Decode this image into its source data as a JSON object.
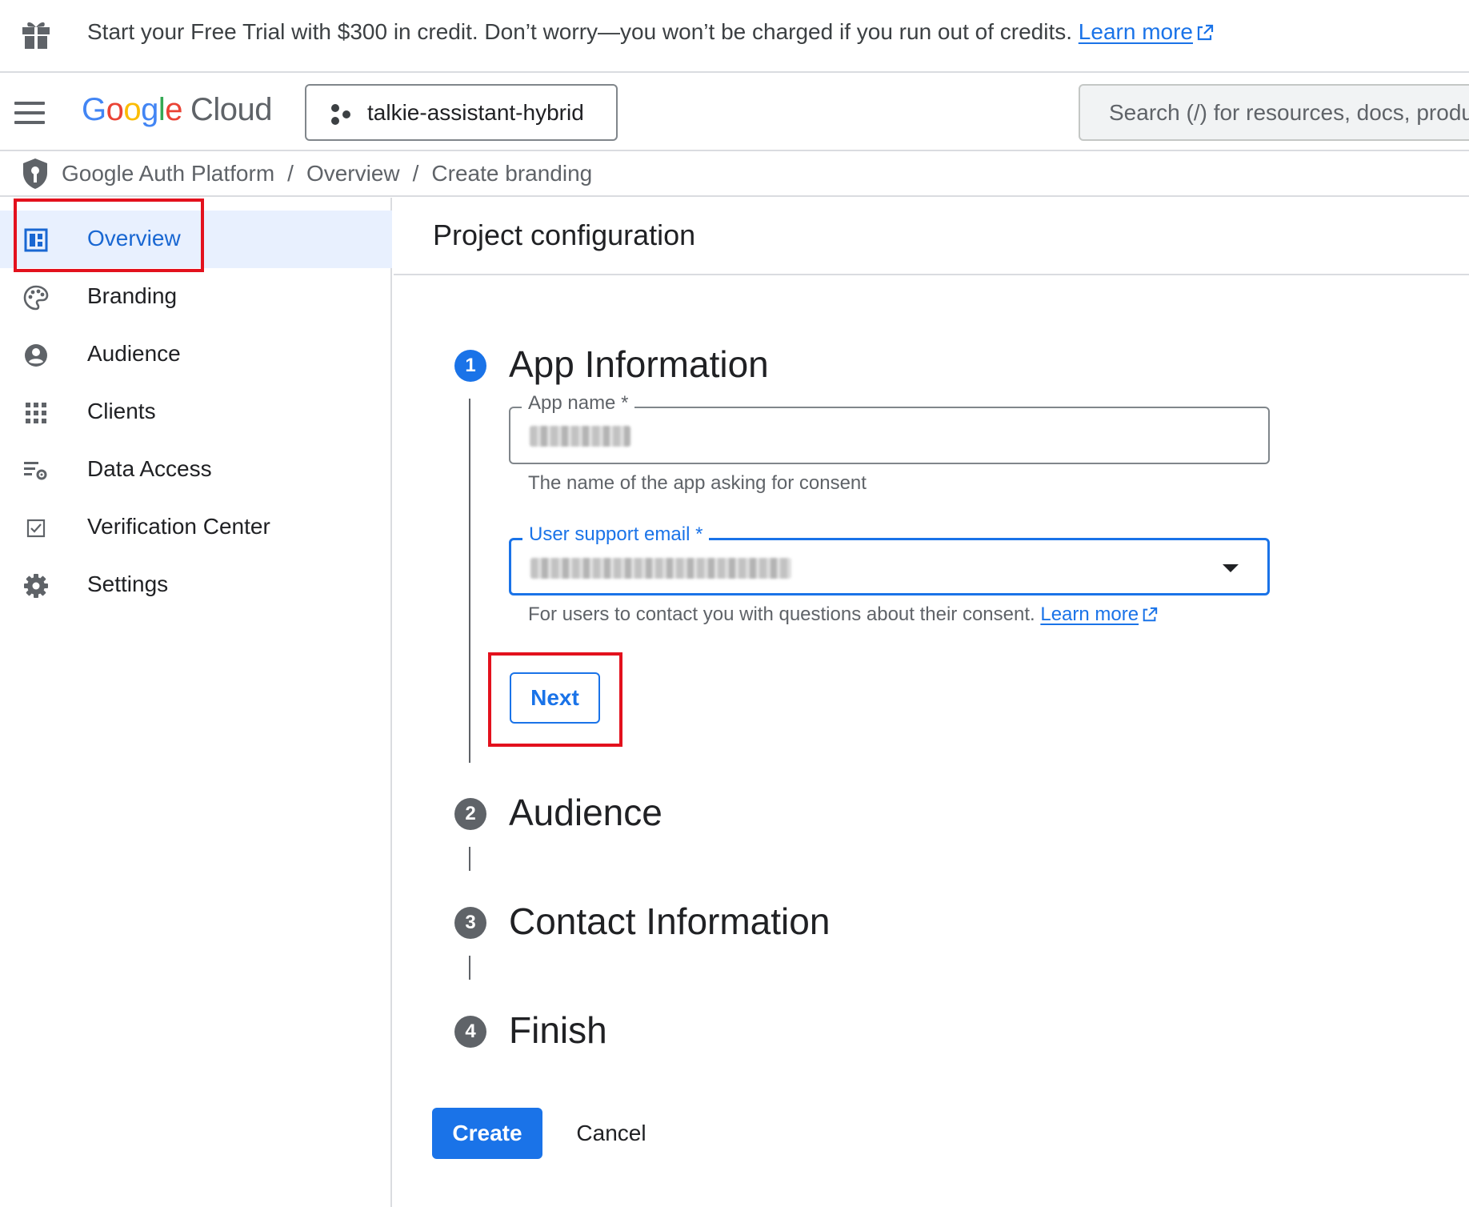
{
  "banner": {
    "text": "Start your Free Trial with $300 in credit. Don’t worry—you won’t be charged if you run out of credits.",
    "link_label": "Learn more"
  },
  "topbar": {
    "logo_letters": [
      "G",
      "o",
      "o",
      "g",
      "l",
      "e"
    ],
    "logo_product": "Cloud",
    "project_name": "talkie-assistant-hybrid",
    "search_placeholder": "Search (/) for resources, docs, products, and more"
  },
  "breadcrumb": {
    "items": [
      "Google Auth Platform",
      "Overview",
      "Create branding"
    ],
    "separator": "/"
  },
  "sidebar": {
    "items": [
      {
        "label": "Overview",
        "icon": "dashboard-icon",
        "active": true
      },
      {
        "label": "Branding",
        "icon": "palette-icon",
        "active": false
      },
      {
        "label": "Audience",
        "icon": "account-circle-icon",
        "active": false
      },
      {
        "label": "Clients",
        "icon": "apps-grid-icon",
        "active": false
      },
      {
        "label": "Data Access",
        "icon": "data-settings-icon",
        "active": false
      },
      {
        "label": "Verification Center",
        "icon": "verified-checkbox-icon",
        "active": false
      },
      {
        "label": "Settings",
        "icon": "gear-icon",
        "active": false
      }
    ]
  },
  "main": {
    "title": "Project configuration",
    "steps": [
      {
        "number": "1",
        "title": "App Information",
        "current": true
      },
      {
        "number": "2",
        "title": "Audience",
        "current": false
      },
      {
        "number": "3",
        "title": "Contact Information",
        "current": false
      },
      {
        "number": "4",
        "title": "Finish",
        "current": false
      }
    ],
    "app_name": {
      "label": "App name *",
      "value": "",
      "hint": "The name of the app asking for consent"
    },
    "support_email": {
      "label": "User support email *",
      "value": "",
      "hint": "For users to contact you with questions about their consent.",
      "hint_link": "Learn more"
    },
    "next_label": "Next",
    "create_label": "Create",
    "cancel_label": "Cancel"
  },
  "colors": {
    "accent": "#1a73e8",
    "highlight_box": "#e3111d",
    "active_nav_bg": "#e8f0fe"
  }
}
